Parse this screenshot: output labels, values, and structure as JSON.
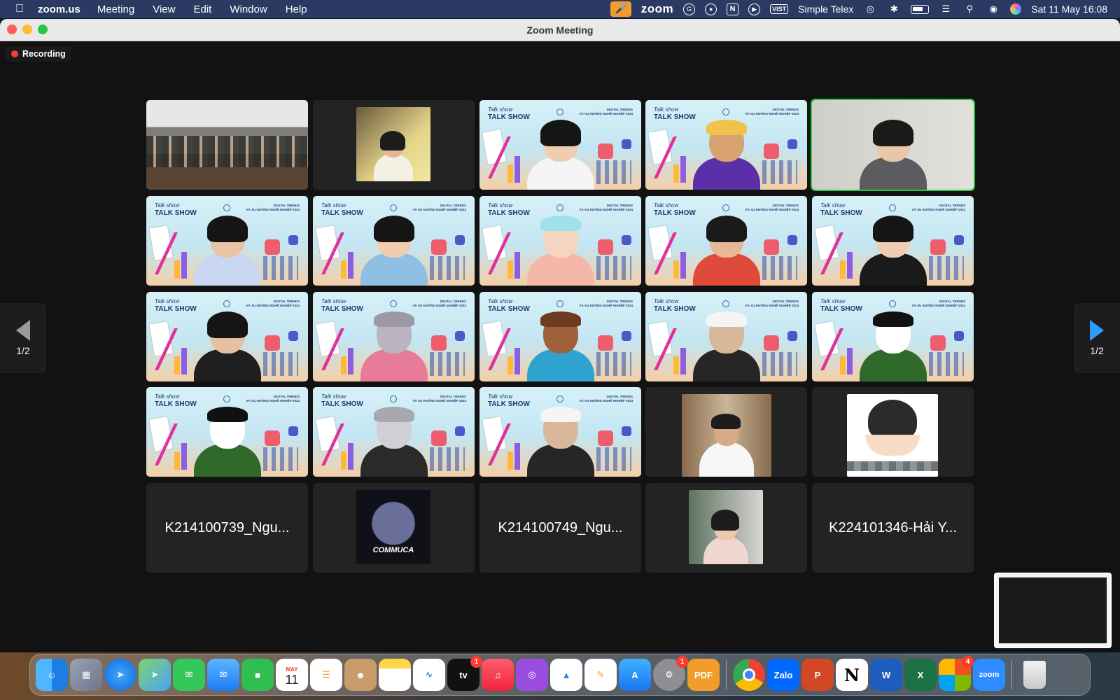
{
  "menubar": {
    "app_name": "zoom.us",
    "items": [
      "Meeting",
      "View",
      "Edit",
      "Window",
      "Help"
    ],
    "zoom_label": "zoom",
    "input_method": "Simple Telex",
    "input_method_badge": "VIST",
    "notion_letter": "N",
    "grammarly_letter": "G",
    "datetime": "Sat 11 May  16:08"
  },
  "window": {
    "title": "Zoom Meeting"
  },
  "meeting": {
    "recording_label": "Recording",
    "page_indicator_prev": "1/2",
    "page_indicator_next": "1/2",
    "tile_names": {
      "r5c1": "K214100739_Ngu...",
      "r5c3": "K214100749_Ngu...",
      "r5c5": "K224101346-Hải Y..."
    },
    "talkshow_title": "TALK SHOW",
    "talkshow_script": "Talk show",
    "talkshow_sub1": "DIGITAL TRENDS",
    "talkshow_sub2": "VÀ XU HƯỚNG NGHỀ NGHIỆP 2024",
    "commuca_label": "COMMUCA"
  },
  "dock": {
    "calendar_month": "MAY",
    "calendar_day": "11",
    "tv_label": "tv",
    "zalo_label": "Zalo",
    "pdf_label": "PDF",
    "word_letter": "W",
    "excel_letter": "X",
    "notion_letter": "N",
    "zoom_label": "zoom",
    "badges": {
      "appletv": "1",
      "settings": "1",
      "office": "4"
    }
  },
  "colors": {
    "menubar": "#2b3a63",
    "accent_blue": "#2d9cff",
    "active_speaker": "#28c840",
    "recording_dot": "#f23d3d"
  }
}
